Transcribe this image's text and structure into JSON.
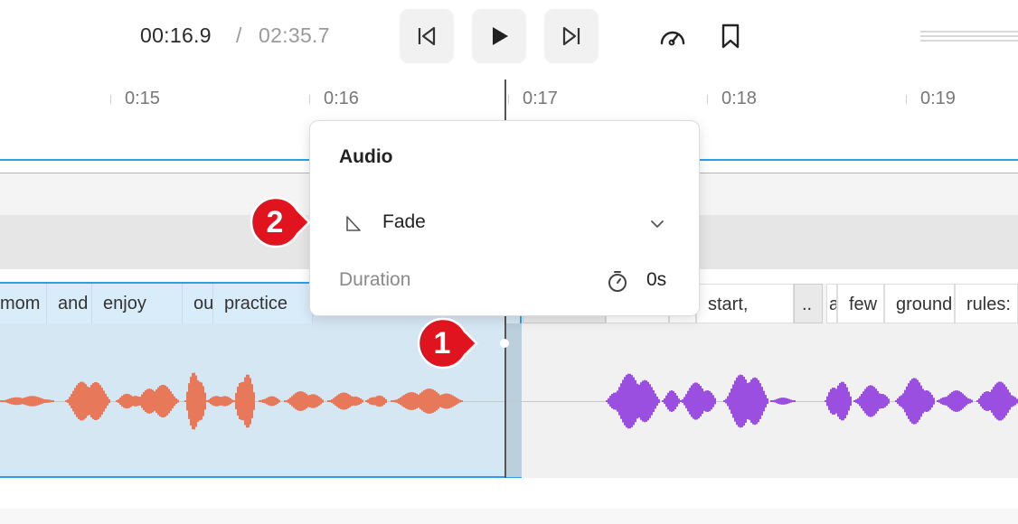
{
  "player": {
    "current_time": "00:16.9",
    "separator": "/",
    "total_time": "02:35.7"
  },
  "icons": {
    "skip_back": "skip-back-icon",
    "play": "play-icon",
    "skip_forward": "skip-forward-icon",
    "speed": "speed-gauge-icon",
    "bookmark": "bookmark-icon",
    "fade": "fade-triangle-icon",
    "chevron": "chevron-down-icon",
    "timer": "stopwatch-icon"
  },
  "ruler": {
    "ticks": [
      "0:15",
      "0:16",
      "0:17",
      "0:18",
      "0:19"
    ]
  },
  "transcript": {
    "words_left": [
      "mom",
      "and",
      "enjoy",
      "ou",
      "practice"
    ],
    "words_right": [
      "start,",
      "..",
      "a",
      "few",
      "ground",
      "rules:"
    ]
  },
  "popup": {
    "title": "Audio",
    "fade_label": "Fade",
    "duration_label": "Duration",
    "duration_value": "0s"
  },
  "markers": {
    "m1": "1",
    "m2": "2"
  },
  "colors": {
    "accent": "#2ea0e6",
    "waveform_left": "#e8785a",
    "waveform_right": "#9b4fe0",
    "marker": "#e0141e"
  }
}
